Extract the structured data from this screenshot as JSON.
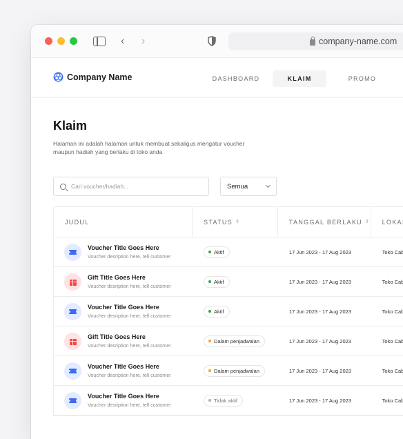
{
  "browser": {
    "url": "company-name.com"
  },
  "nav": {
    "brand": "Company Name",
    "items": [
      {
        "label": "DASHBOARD"
      },
      {
        "label": "KLAIM"
      },
      {
        "label": "PROMO"
      }
    ]
  },
  "page": {
    "title": "Klaim",
    "description": "Halaman ini adalah halaman untuk membuat sekaligus mengatur voucher maupun hadiah yang berlaku di toko anda"
  },
  "filters": {
    "search_placeholder": "Cari voucher/hadiah...",
    "select_value": "Semua"
  },
  "table": {
    "columns": [
      {
        "label": "JUDUL"
      },
      {
        "label": "STATUS"
      },
      {
        "label": "TANGGAL BERLAKU"
      },
      {
        "label": "LOKASI"
      }
    ],
    "rows": [
      {
        "type": "voucher",
        "icon": "ticket-icon",
        "title": "Voucher Title Goes Here",
        "desc": "Voucher desription here, tell customer",
        "status": "Aktif",
        "status_color": "#2fa84f",
        "date": "17 Jun 2023 - 17 Aug 2023",
        "location": "Toko Cabang"
      },
      {
        "type": "gift",
        "icon": "gift-icon",
        "title": "Gift Title Goes Here",
        "desc": "Voucher desription here, tell customer",
        "status": "Aktif",
        "status_color": "#2fa84f",
        "date": "17 Jun 2023 - 17 Aug 2023",
        "location": "Toko Cabang"
      },
      {
        "type": "voucher",
        "icon": "ticket-icon",
        "title": "Voucher Title Goes Here",
        "desc": "Voucher desription here, tell customer",
        "status": "Aktif",
        "status_color": "#2fa84f",
        "date": "17 Jun 2023 - 17 Aug 2023",
        "location": "Toko Cabang"
      },
      {
        "type": "gift",
        "icon": "gift-icon",
        "title": "Gift Title Goes Here",
        "desc": "Voucher desription here, tell customer",
        "status": "Dalam penjadwalan",
        "status_color": "#f5a03c",
        "date": "17 Jun 2023 - 17 Aug 2023",
        "location": "Toko Cabang"
      },
      {
        "type": "voucher",
        "icon": "ticket-icon",
        "title": "Voucher Title Goes Here",
        "desc": "Voucher desription here, tell customer",
        "status": "Dalam penjadwalan",
        "status_color": "#f5a03c",
        "date": "17 Jun 2023 - 17 Aug 2023",
        "location": "Toko Cabang"
      },
      {
        "type": "voucher",
        "icon": "ticket-icon",
        "title": "Voucher Title Goes Here",
        "desc": "Voucher desription here, tell customer",
        "status": "Tidak aktif",
        "status_color": "#b0b0b0",
        "date": "17 Jun 2023 - 17 Aug 2023",
        "location": "Toko Cabang"
      }
    ]
  },
  "colors": {
    "brand": "#3b6af5",
    "active": "#2fa84f",
    "scheduled": "#f5a03c",
    "inactive": "#b0b0b0"
  }
}
